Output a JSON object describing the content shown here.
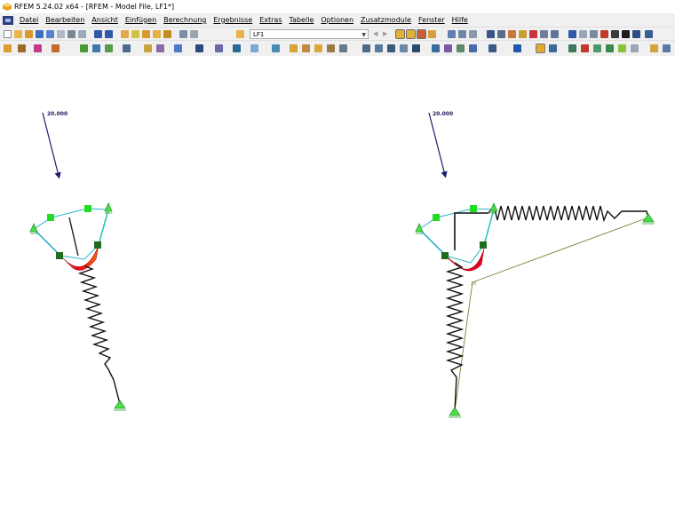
{
  "window": {
    "title": "RFEM 5.24.02 x64 - [RFEM - Model File, LF1*]",
    "icon": "rfem-app-icon"
  },
  "menu": {
    "items": [
      "Datei",
      "Bearbeiten",
      "Ansicht",
      "Einfügen",
      "Berechnung",
      "Ergebnisse",
      "Extras",
      "Tabelle",
      "Optionen",
      "Zusatzmodule",
      "Fenster",
      "Hilfe"
    ]
  },
  "toolbar": {
    "load_case": "LF1"
  },
  "model": {
    "left_load_label": "20.000",
    "right_load_label": "20.000"
  },
  "colors": {
    "load_arrow": "#1a1a6e",
    "support": "#4ade4a",
    "node_light": "#22dd22",
    "node_dark": "#1f6b1f",
    "spring": "#111111",
    "deform_hot": "#e8001a",
    "deform_warm": "#f5a623",
    "member_line": "#7d7d3a"
  }
}
